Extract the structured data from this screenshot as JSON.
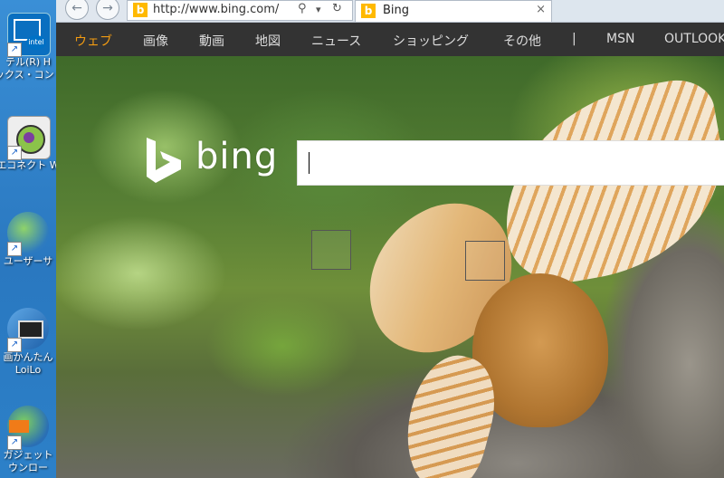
{
  "desktop": {
    "icons": [
      {
        "name": "intel-graphics",
        "label": "テル(R) H",
        "label2": "ックス・コント"
      },
      {
        "name": "e-connect",
        "label": "エコネクト W",
        "label2": ""
      },
      {
        "name": "user-support",
        "label": "ユーザーサ",
        "label2": ""
      },
      {
        "name": "loilo-video",
        "label": "画かんたん",
        "label2": "LoiLo"
      },
      {
        "name": "gadget-download",
        "label": "ガジェット",
        "label2": "ウンロー"
      }
    ],
    "shortcut_glyph": "↗"
  },
  "browser": {
    "back_glyph": "←",
    "forward_glyph": "→",
    "url": "http://www.bing.com/",
    "search_glyph": "⚲",
    "dropdown_glyph": "▾",
    "refresh_glyph": "↻",
    "tab_title": "Bing",
    "tab_close": "×",
    "favicon_glyph": "b"
  },
  "bing": {
    "nav": [
      "ウェブ",
      "画像",
      "動画",
      "地図",
      "ニュース",
      "ショッピング",
      "その他",
      "|",
      "MSN",
      "OUTLOOK"
    ],
    "logo_text": "bing",
    "search_value": ""
  },
  "colors": {
    "nav_bg": "#333333",
    "nav_active": "#f39c12",
    "bing_logo": "#ffffff"
  }
}
